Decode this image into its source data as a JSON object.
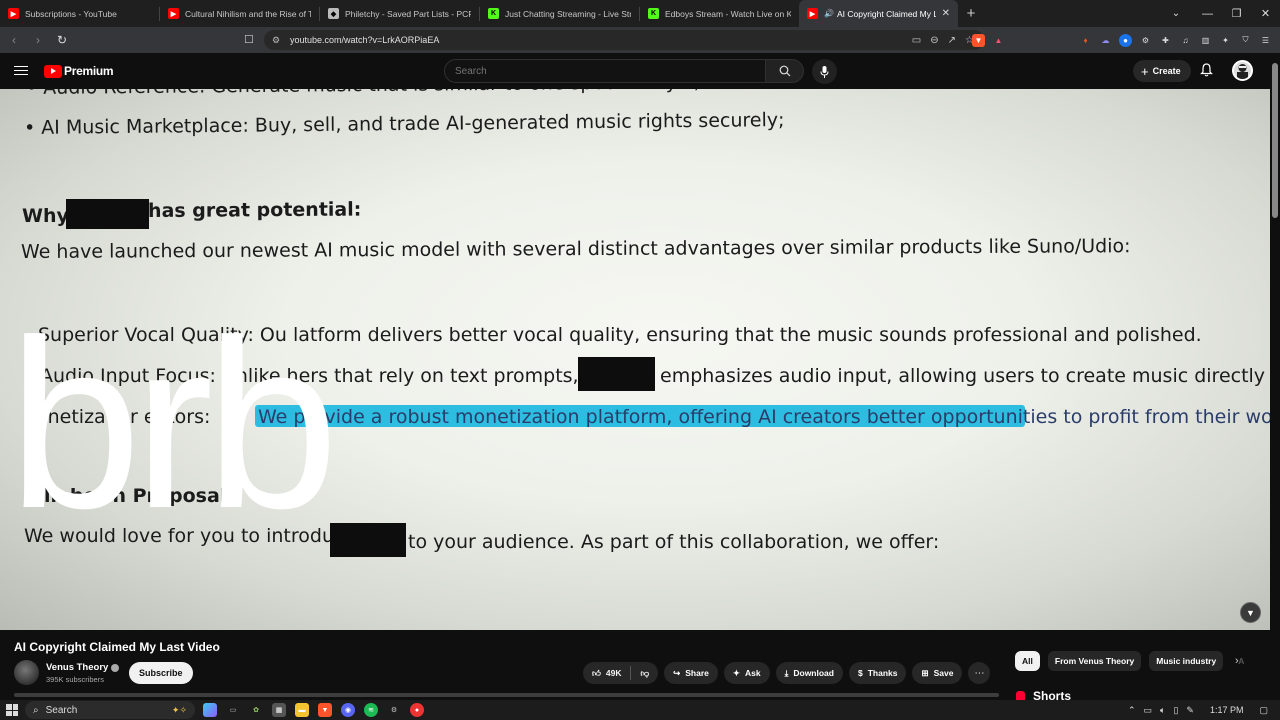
{
  "browser": {
    "tabs": [
      {
        "title": "Subscriptions - YouTube",
        "favicon": "youtube-icon",
        "color": "#ff0000",
        "active": false
      },
      {
        "title": "Cultural Nihilism and the Rise of Th",
        "favicon": "youtube-icon",
        "color": "#ff0000",
        "active": false
      },
      {
        "title": "Philetchy - Saved Part Lists - PCPartP",
        "favicon": "pcpartpicker-icon",
        "color": "#bbbbbb",
        "active": false
      },
      {
        "title": "Just Chatting Streaming - Live Strea",
        "favicon": "kick-icon",
        "color": "#53fc18",
        "active": false
      },
      {
        "title": "Edboys Stream - Watch Live on Kick",
        "favicon": "kick-icon",
        "color": "#53fc18",
        "active": false
      },
      {
        "title": "AI Copyright Claimed My La",
        "favicon": "youtube-icon",
        "color": "#ff0000",
        "active": true
      }
    ],
    "new_tab_label": "+",
    "url": "youtube.com/watch?v=LrkAORPiaEA"
  },
  "youtube": {
    "brand": "Premium",
    "search_placeholder": "Search",
    "create_label": "Create",
    "accent": "#ff0000"
  },
  "video_frame": {
    "lines": [
      {
        "text": "• Audio Reference: Generate music that is similar to one specific style;"
      },
      {
        "text": "• AI Music Marketplace: Buy, sell, and trade AI-generated music rights securely;"
      },
      {
        "text": "Why",
        "bold": true
      },
      {
        "text": "has great potential:",
        "bold": true
      },
      {
        "text": "We have launched our newest AI music model with several distinct advantages over similar products like Suno/Udio:"
      },
      {
        "text": "Superior Vocal Quality: Ou    latform delivers better vocal quality, ensuring that the music sounds professional and polished."
      },
      {
        "text": "Audio Input Focus: Unlike     hers that rely on text prompts,"
      },
      {
        "text": "emphasizes audio input, allowing users to create music directly from"
      },
      {
        "text": "onetiza     for    eators:"
      },
      {
        "text": "We provide a robust monetization platform, offering AI creators better opportunities to profit from their work"
      },
      {
        "text": "llabor     n Proposal:",
        "bold": true
      },
      {
        "text": "We would love for you to introduce"
      },
      {
        "text": "to your audience. As part of this collaboration, we offer:"
      }
    ],
    "overlay_text": "brb",
    "highlight_color": "#22b9e0"
  },
  "video": {
    "title": "AI Copyright Claimed My Last Video",
    "channel": "Venus Theory",
    "subscribers": "395K subscribers",
    "subscribe_label": "Subscribe",
    "likes": "49K",
    "actions": [
      {
        "label": "Share",
        "icon": "share-icon"
      },
      {
        "label": "Ask",
        "icon": "sparkle-icon"
      },
      {
        "label": "Download",
        "icon": "download-icon"
      },
      {
        "label": "Thanks",
        "icon": "thanks-icon"
      },
      {
        "label": "Save",
        "icon": "save-icon"
      }
    ]
  },
  "sidebar": {
    "chips": [
      "All",
      "From Venus Theory",
      "Music industry",
      "A"
    ],
    "shorts_label": "Shorts"
  },
  "taskbar": {
    "search_placeholder": "Search",
    "time": "1:17 PM"
  }
}
